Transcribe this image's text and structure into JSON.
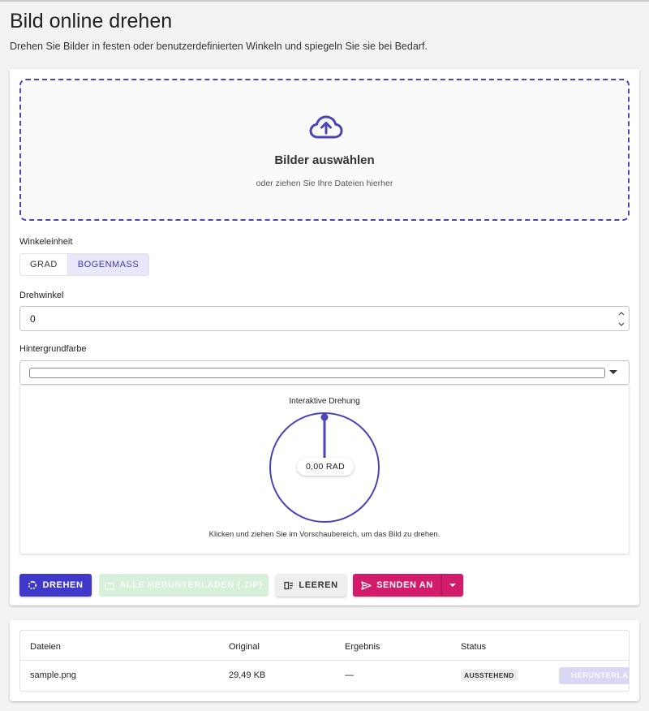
{
  "page": {
    "title": "Bild online drehen",
    "subtitle": "Drehen Sie Bilder in festen oder benutzerdefinierten Winkeln und spiegeln Sie sie bei Bedarf."
  },
  "dropzone": {
    "icon": "cloud-upload-icon",
    "title": "Bilder auswählen",
    "hint": "oder ziehen Sie Ihre Dateien hierher"
  },
  "angle_unit": {
    "label": "Winkeleinheit",
    "options": [
      "GRAD",
      "BOGENMASS"
    ],
    "selected": "BOGENMASS"
  },
  "rotation_angle": {
    "label": "Drehwinkel",
    "value": "0",
    "spinner_icons": [
      "chevron-up-icon",
      "chevron-down-icon"
    ]
  },
  "background_color": {
    "label": "Hintergrundfarbe",
    "value": "#ffffff"
  },
  "interactive": {
    "title": "Interaktive Drehung",
    "readout": "0,00 RAD",
    "hint": "Klicken und ziehen Sie im Vorschaubereich, um das Bild zu drehen.",
    "angle_rad": 0
  },
  "actions": {
    "rotate": "DREHEN",
    "download_all": "ALLE HERUNTERLADEN (.ZIP)",
    "clear": "LEEREN",
    "send_to": "SENDEN AN"
  },
  "files_table": {
    "headers": [
      "Dateien",
      "Original",
      "Ergebnis",
      "Status"
    ],
    "rows": [
      {
        "name": "sample.png",
        "original": "29,49 KB",
        "result": "—",
        "status": "AUSSTEHEND",
        "download": "HERUNTERLADEN"
      }
    ]
  },
  "colors": {
    "accent": "#3f38c9",
    "send": "#d31b6b",
    "download_disabled": "#d8efd9"
  }
}
